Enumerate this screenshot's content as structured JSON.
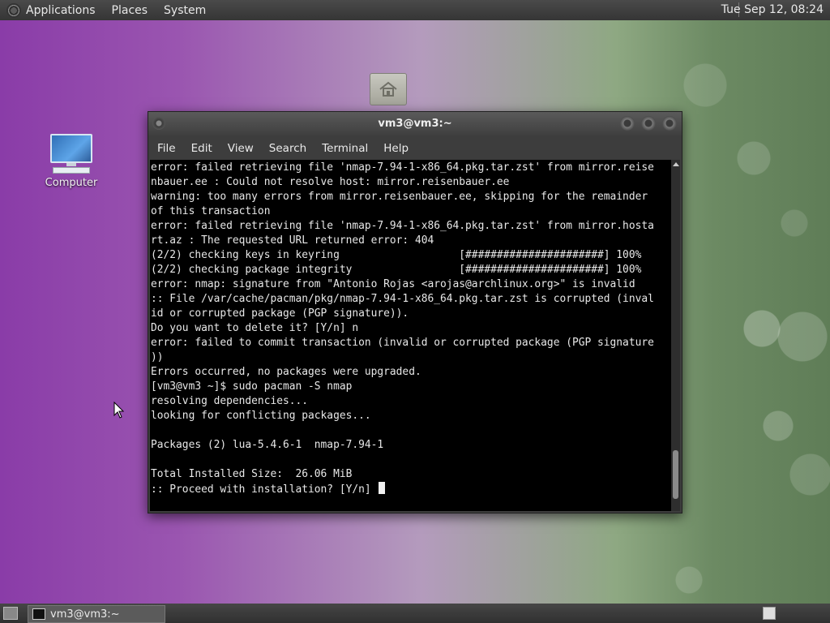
{
  "top_panel": {
    "menus": [
      "Applications",
      "Places",
      "System"
    ],
    "clock": "Tue Sep 12, 08:24"
  },
  "desktop": {
    "icons": [
      {
        "label": "Computer",
        "icon": "computer-icon"
      },
      {
        "label": "",
        "icon": "home-folder-icon"
      }
    ]
  },
  "terminal": {
    "title": "vm3@vm3:~",
    "menu": [
      "File",
      "Edit",
      "View",
      "Search",
      "Terminal",
      "Help"
    ],
    "lines": [
      "error: failed retrieving file 'nmap-7.94-1-x86_64.pkg.tar.zst' from mirror.reise",
      "nbauer.ee : Could not resolve host: mirror.reisenbauer.ee",
      "warning: too many errors from mirror.reisenbauer.ee, skipping for the remainder",
      "of this transaction",
      "error: failed retrieving file 'nmap-7.94-1-x86_64.pkg.tar.zst' from mirror.hosta",
      "rt.az : The requested URL returned error: 404",
      "(2/2) checking keys in keyring                   [######################] 100%",
      "(2/2) checking package integrity                 [######################] 100%",
      "error: nmap: signature from \"Antonio Rojas <arojas@archlinux.org>\" is invalid",
      ":: File /var/cache/pacman/pkg/nmap-7.94-1-x86_64.pkg.tar.zst is corrupted (inval",
      "id or corrupted package (PGP signature)).",
      "Do you want to delete it? [Y/n] n",
      "error: failed to commit transaction (invalid or corrupted package (PGP signature",
      "))",
      "Errors occurred, no packages were upgraded.",
      "[vm3@vm3 ~]$ sudo pacman -S nmap",
      "resolving dependencies...",
      "looking for conflicting packages...",
      "",
      "Packages (2) lua-5.4.6-1  nmap-7.94-1",
      "",
      "Total Installed Size:  26.06 MiB",
      ""
    ],
    "prompt_line": ":: Proceed with installation? [Y/n] "
  },
  "taskbar": {
    "tasks": [
      {
        "label": "vm3@vm3:~"
      }
    ]
  }
}
